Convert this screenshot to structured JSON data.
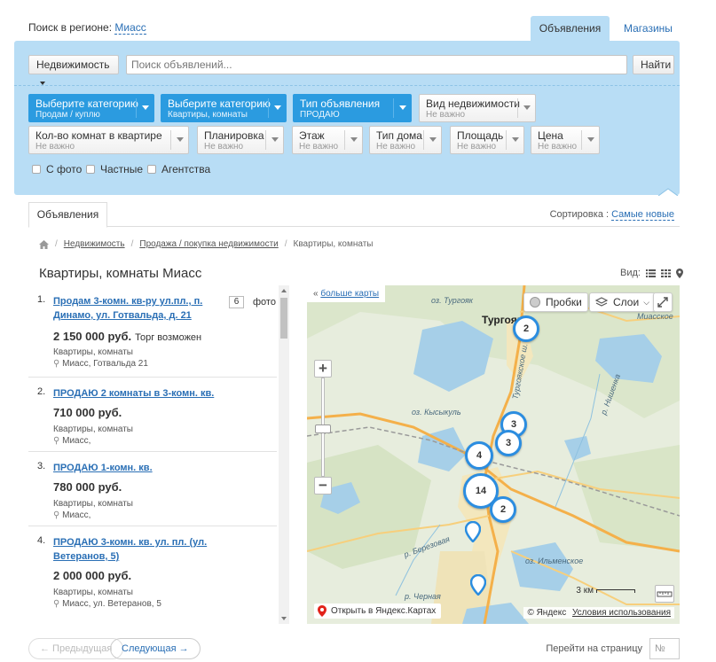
{
  "header": {
    "region_label": "Поиск в регионе:",
    "region_value": "Миасс",
    "tabs": [
      {
        "label": "Объявления",
        "active": true
      },
      {
        "label": "Магазины",
        "active": false
      }
    ]
  },
  "search": {
    "category_button": "Недвижимость",
    "placeholder": "Поиск объявлений...",
    "submit": "Найти"
  },
  "filters": [
    {
      "title": "Выберите категорию",
      "value": "Продам / куплю",
      "active": true
    },
    {
      "title": "Выберите категорию",
      "value": "Квартиры, комнаты",
      "active": true
    },
    {
      "title": "Тип объявления",
      "value": "ПРОДАЮ",
      "active": true
    },
    {
      "title": "Вид недвижимости",
      "value": "Не важно",
      "active": false
    },
    {
      "title": "Кол-во комнат в квартире",
      "value": "Не важно",
      "active": false
    },
    {
      "title": "Планировка",
      "value": "Не важно",
      "active": false
    },
    {
      "title": "Этаж",
      "value": "Не важно",
      "active": false
    },
    {
      "title": "Тип дома",
      "value": "Не важно",
      "active": false
    },
    {
      "title": "Площадь",
      "value": "Не важно",
      "active": false
    },
    {
      "title": "Цена",
      "value": "Не важно",
      "active": false
    }
  ],
  "checkboxes": [
    "С фото",
    "Частные",
    "Агентства"
  ],
  "results_tab": "Объявления",
  "sort": {
    "label": "Сортировка :",
    "value": "Самые новые"
  },
  "breadcrumbs": [
    "Недвижимость",
    "Продажа / покупка недвижимости",
    "Квартиры, комнаты"
  ],
  "page_title": "Квартиры, комнаты Миасс",
  "view_label": "Вид:",
  "listings": [
    {
      "num": "1.",
      "title": "Продам 3-комн. кв-ру ул.пл., п. Динамо, ул. Готвальда, д. 21",
      "price": "2 150 000 руб.",
      "torg": "Торг возможен",
      "category": "Квартиры, комнаты",
      "address": "Миасс, Готвальда 21",
      "photos": "6",
      "photo_label": "фото"
    },
    {
      "num": "2.",
      "title": "ПРОДАЮ 2 комнаты в 3-комн. кв.",
      "price": "710 000 руб.",
      "torg": "",
      "category": "Квартиры, комнаты",
      "address": "Миасс,"
    },
    {
      "num": "3.",
      "title": "ПРОДАЮ 1-комн. кв.",
      "price": "780 000 руб.",
      "torg": "",
      "category": "Квартиры, комнаты",
      "address": "Миасс,"
    },
    {
      "num": "4.",
      "title": "ПРОДАЮ 3-комн. кв. ул. пл. (ул. Ветеранов, 5)",
      "price": "2 000 000 руб.",
      "torg": "",
      "category": "Квартиры, комнаты",
      "address": "Миасс, ул. Ветеранов, 5"
    }
  ],
  "map": {
    "more_prefix": "«",
    "more_link": "больше карты",
    "traffic_button": "Пробки",
    "layers_button": "Слои",
    "city": "Тургояк",
    "labels": {
      "turgoyak_lake": "оз. Тургояк",
      "bolshoe_miasskoe": "оз. Большое Миасское",
      "kysykul": "оз. Кысыкуль",
      "ilmenskoe": "оз. Ильменское",
      "berezovaya": "р. Березовая",
      "chernaya": "р. Черная",
      "nishenka": "р. Нишенка",
      "turgoyak_road": "Тургоякское ш."
    },
    "clusters": [
      "2",
      "3",
      "3",
      "4",
      "14",
      "2"
    ],
    "scale": "3 км",
    "open_yandex": "Открыть в Яндекс.Картах",
    "copyright": "© Яндекс",
    "terms": "Условия использования"
  },
  "pager": {
    "prev": "← Предыдущая",
    "next": "Следующая →",
    "goto_label": "Перейти на страницу",
    "goto_placeholder": "№"
  },
  "colors": {
    "panel": "#b8ddf5",
    "active_filter": "#2b9be0",
    "link": "#2a6fb5",
    "cluster_border": "#2b8de0"
  }
}
